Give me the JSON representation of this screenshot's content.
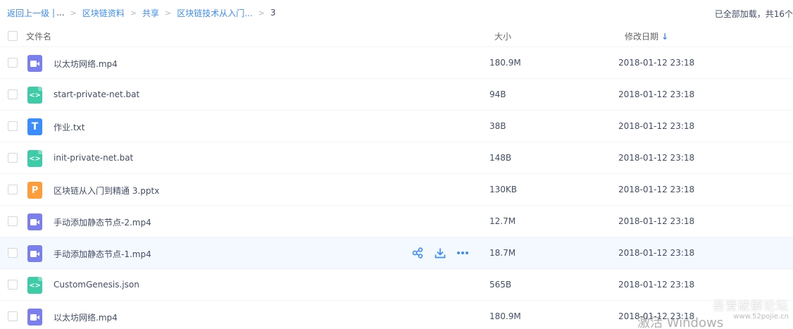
{
  "breadcrumb": {
    "back": "返回上一级",
    "pipe": "|",
    "ellipsis": "...",
    "items": [
      "区块链资料",
      "共享",
      "区块链技术从入门..."
    ],
    "current": "3",
    "separator": ">"
  },
  "status": {
    "loaded_text": "已全部加载，共16个"
  },
  "columns": {
    "name": "文件名",
    "size": "大小",
    "date": "修改日期",
    "sort_arrow": "↓"
  },
  "files": [
    {
      "name": "以太坊网络.mp4",
      "size": "180.9M",
      "date": "2018-01-12 23:18",
      "type": "video",
      "glyph": ""
    },
    {
      "name": "start-private-net.bat",
      "size": "94B",
      "date": "2018-01-12 23:18",
      "type": "code",
      "glyph": "<>"
    },
    {
      "name": "作业.txt",
      "size": "38B",
      "date": "2018-01-12 23:18",
      "type": "text",
      "glyph": "T"
    },
    {
      "name": "init-private-net.bat",
      "size": "148B",
      "date": "2018-01-12 23:18",
      "type": "code",
      "glyph": "<>"
    },
    {
      "name": "区块链从入门到精通 3.pptx",
      "size": "130KB",
      "date": "2018-01-12 23:18",
      "type": "ppt",
      "glyph": "P"
    },
    {
      "name": "手动添加静态节点-2.mp4",
      "size": "12.7M",
      "date": "2018-01-12 23:18",
      "type": "video",
      "glyph": ""
    },
    {
      "name": "手动添加静态节点-1.mp4",
      "size": "18.7M",
      "date": "2018-01-12 23:18",
      "type": "video",
      "glyph": ""
    },
    {
      "name": "CustomGenesis.json",
      "size": "565B",
      "date": "2018-01-12 23:18",
      "type": "code",
      "glyph": "<>"
    },
    {
      "name": "以太坊网络.mp4",
      "size": "180.9M",
      "date": "2018-01-12 23:18",
      "type": "video",
      "glyph": ""
    }
  ],
  "hover_row_index": 6,
  "watermark": {
    "forum": "吾爱破解论坛",
    "url": "www.52pojie.cn",
    "activate": "激活 Windows"
  },
  "colors": {
    "accent": "#3b8cff",
    "video": "#7b7fee",
    "code": "#3dcca6",
    "text": "#3b8cff",
    "ppt": "#ff9c3b",
    "hover_bg": "#f4f9ff"
  }
}
